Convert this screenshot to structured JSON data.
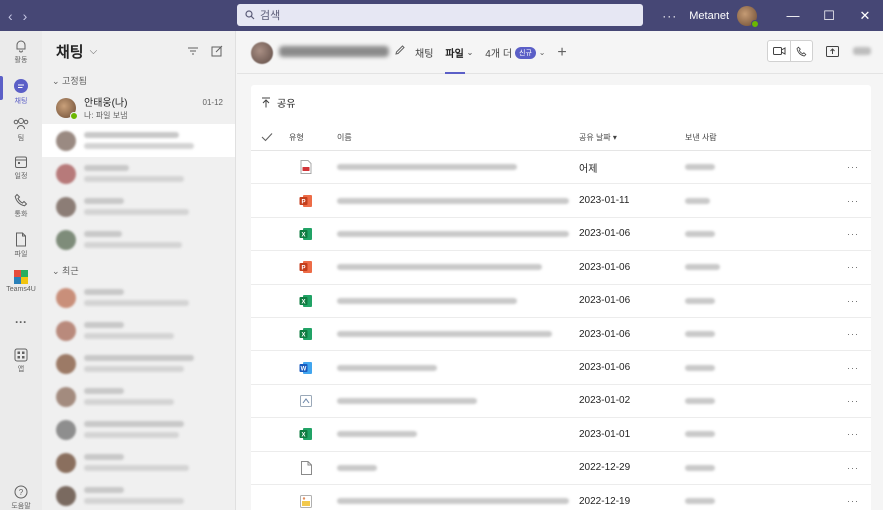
{
  "titlebar": {
    "search_placeholder": "검색",
    "more_label": "···",
    "user_name": "Metanet",
    "minimize": "—",
    "maximize": "☐",
    "close": "✕"
  },
  "rail": {
    "items": [
      {
        "label": "활동",
        "icon": "bell-icon"
      },
      {
        "label": "채팅",
        "icon": "chat-icon"
      },
      {
        "label": "팀",
        "icon": "teams-icon"
      },
      {
        "label": "일정",
        "icon": "calendar-icon"
      },
      {
        "label": "통화",
        "icon": "phone-icon"
      },
      {
        "label": "파일",
        "icon": "file-icon"
      },
      {
        "label": "Teams4U",
        "icon": "teams4u-icon"
      },
      {
        "label": "···",
        "icon": "more-icon"
      },
      {
        "label": "앱",
        "icon": "apps-icon"
      },
      {
        "label": "도움말",
        "icon": "help-icon"
      }
    ]
  },
  "chatlist": {
    "title": "채팅",
    "pinned_label": "고정됨",
    "recent_label": "최근",
    "pinned_item": {
      "name": "안태웅(나)",
      "preview": "나: 파일 보냄",
      "time": "01-12"
    }
  },
  "header": {
    "tabs": [
      {
        "label": "채팅"
      },
      {
        "label": "파일"
      },
      {
        "label": "4개 더"
      }
    ],
    "new_badge": "신규",
    "add_tab": "+"
  },
  "files": {
    "share_label": "공유",
    "columns": {
      "type": "유형",
      "name": "이름",
      "date": "공유 날짜",
      "sender": "보낸 사람"
    },
    "rows": [
      {
        "type": "pdf",
        "date": "어제"
      },
      {
        "type": "pptx",
        "date": "2023-01-11"
      },
      {
        "type": "xlsx",
        "date": "2023-01-06"
      },
      {
        "type": "pptx",
        "date": "2023-01-06"
      },
      {
        "type": "xlsx",
        "date": "2023-01-06"
      },
      {
        "type": "xlsx",
        "date": "2023-01-06"
      },
      {
        "type": "docx",
        "date": "2023-01-06"
      },
      {
        "type": "generic",
        "date": "2023-01-02"
      },
      {
        "type": "xlsx",
        "date": "2023-01-01"
      },
      {
        "type": "blank",
        "date": "2022-12-29"
      },
      {
        "type": "image",
        "date": "2022-12-19"
      }
    ],
    "more_label": "···"
  },
  "colors": {
    "titlebar": "#464775",
    "accent": "#5b5fc7",
    "excel": "#107c41",
    "powerpoint": "#c43e1c",
    "word": "#185abd",
    "pdf": "#d13438"
  }
}
